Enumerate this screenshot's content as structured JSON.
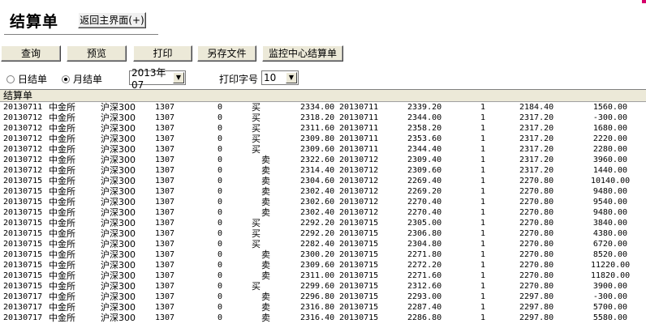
{
  "title": "结算单",
  "back_button": "返回主界面(+)",
  "toolbar": [
    "查询",
    "预览",
    "打印",
    "另存文件",
    "监控中心结算单"
  ],
  "options": {
    "daily_label": "日结单",
    "monthly_label": "月结单",
    "month_value": "2013年07",
    "font_label": "打印字号",
    "font_value": "10"
  },
  "grid_header": "结算单",
  "rows": [
    [
      "20130711",
      "中金所",
      "沪深300",
      "1307",
      "0",
      "买",
      "2334.00",
      "20130711",
      "2339.20",
      "1",
      "2184.40",
      "1560.00"
    ],
    [
      "20130712",
      "中金所",
      "沪深300",
      "1307",
      "0",
      "买",
      "2318.20",
      "20130711",
      "2344.00",
      "1",
      "2317.20",
      "-300.00"
    ],
    [
      "20130712",
      "中金所",
      "沪深300",
      "1307",
      "0",
      "买",
      "2311.60",
      "20130711",
      "2358.20",
      "1",
      "2317.20",
      "1680.00"
    ],
    [
      "20130712",
      "中金所",
      "沪深300",
      "1307",
      "0",
      "买",
      "2309.80",
      "20130711",
      "2353.60",
      "1",
      "2317.20",
      "2220.00"
    ],
    [
      "20130712",
      "中金所",
      "沪深300",
      "1307",
      "0",
      "买",
      "2309.60",
      "20130711",
      "2344.40",
      "1",
      "2317.20",
      "2280.00"
    ],
    [
      "20130712",
      "中金所",
      "沪深300",
      "1307",
      "0",
      "卖",
      "2322.60",
      "20130712",
      "2309.40",
      "1",
      "2317.20",
      "3960.00"
    ],
    [
      "20130712",
      "中金所",
      "沪深300",
      "1307",
      "0",
      "卖",
      "2314.40",
      "20130712",
      "2309.60",
      "1",
      "2317.20",
      "1440.00"
    ],
    [
      "20130715",
      "中金所",
      "沪深300",
      "1307",
      "0",
      "卖",
      "2304.60",
      "20130712",
      "2269.40",
      "1",
      "2270.80",
      "10140.00"
    ],
    [
      "20130715",
      "中金所",
      "沪深300",
      "1307",
      "0",
      "卖",
      "2302.40",
      "20130712",
      "2269.20",
      "1",
      "2270.80",
      "9480.00"
    ],
    [
      "20130715",
      "中金所",
      "沪深300",
      "1307",
      "0",
      "卖",
      "2302.60",
      "20130712",
      "2270.40",
      "1",
      "2270.80",
      "9540.00"
    ],
    [
      "20130715",
      "中金所",
      "沪深300",
      "1307",
      "0",
      "卖",
      "2302.40",
      "20130712",
      "2270.40",
      "1",
      "2270.80",
      "9480.00"
    ],
    [
      "20130715",
      "中金所",
      "沪深300",
      "1307",
      "0",
      "买",
      "2292.20",
      "20130715",
      "2305.00",
      "1",
      "2270.80",
      "3840.00"
    ],
    [
      "20130715",
      "中金所",
      "沪深300",
      "1307",
      "0",
      "买",
      "2292.20",
      "20130715",
      "2306.80",
      "1",
      "2270.80",
      "4380.00"
    ],
    [
      "20130715",
      "中金所",
      "沪深300",
      "1307",
      "0",
      "买",
      "2282.40",
      "20130715",
      "2304.80",
      "1",
      "2270.80",
      "6720.00"
    ],
    [
      "20130715",
      "中金所",
      "沪深300",
      "1307",
      "0",
      "卖",
      "2300.20",
      "20130715",
      "2271.80",
      "1",
      "2270.80",
      "8520.00"
    ],
    [
      "20130715",
      "中金所",
      "沪深300",
      "1307",
      "0",
      "卖",
      "2309.60",
      "20130715",
      "2272.20",
      "1",
      "2270.80",
      "11220.00"
    ],
    [
      "20130715",
      "中金所",
      "沪深300",
      "1307",
      "0",
      "卖",
      "2311.00",
      "20130715",
      "2271.60",
      "1",
      "2270.80",
      "11820.00"
    ],
    [
      "20130715",
      "中金所",
      "沪深300",
      "1307",
      "0",
      "买",
      "2299.60",
      "20130715",
      "2312.60",
      "1",
      "2270.80",
      "3900.00"
    ],
    [
      "20130717",
      "中金所",
      "沪深300",
      "1307",
      "0",
      "卖",
      "2296.80",
      "20130715",
      "2293.00",
      "1",
      "2297.80",
      "-300.00"
    ],
    [
      "20130717",
      "中金所",
      "沪深300",
      "1307",
      "0",
      "卖",
      "2316.80",
      "20130715",
      "2287.40",
      "1",
      "2297.80",
      "5700.00"
    ],
    [
      "20130717",
      "中金所",
      "沪深300",
      "1307",
      "0",
      "卖",
      "2316.40",
      "20130715",
      "2286.80",
      "1",
      "2297.80",
      "5580.00"
    ]
  ]
}
